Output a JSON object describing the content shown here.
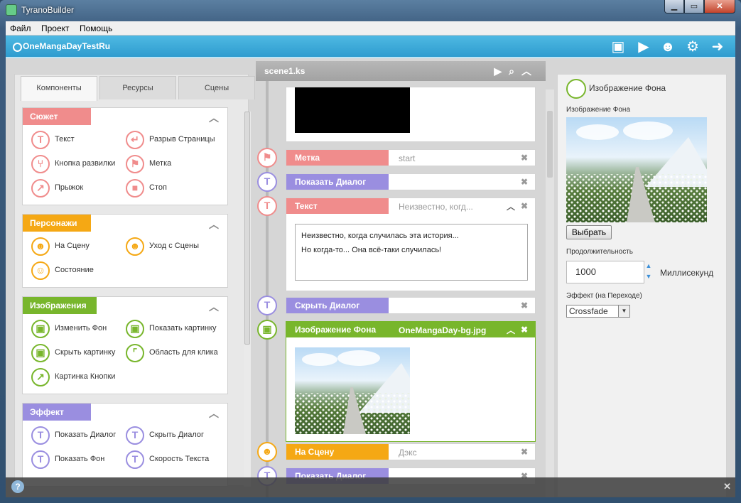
{
  "window": {
    "title": "TyranoBuilder",
    "min": "▁",
    "max": "▭",
    "close": "✕"
  },
  "menu": [
    "Файл",
    "Проект",
    "Помощь"
  ],
  "header": {
    "project": "OneMangaDayTestRu",
    "icons": [
      "save-icon",
      "play-icon",
      "characters-icon",
      "settings-icon",
      "exit-icon"
    ]
  },
  "tabs": [
    "Компоненты",
    "Ресурсы",
    "Сцены"
  ],
  "categories": [
    {
      "title": "Сюжет",
      "color": "#f08c8c",
      "items": [
        "Текст",
        "Разрыв Страницы",
        "Кнопка развилки",
        "Метка",
        "Прыжок",
        "Стоп"
      ]
    },
    {
      "title": "Персонажи",
      "color": "#f5a814",
      "items": [
        "На Сцену",
        "Уход с Сцены",
        "Состояние"
      ]
    },
    {
      "title": "Изображения",
      "color": "#78b62c",
      "items": [
        "Изменить Фон",
        "Показать картинку",
        "Скрыть картинку",
        "Область для клика",
        "Картинка Кнопки"
      ]
    },
    {
      "title": "Эффект",
      "color": "#9a8ee0",
      "items": [
        "Показать Диалог",
        "Скрыть Диалог",
        "Показать Фон",
        "Скорость Текста"
      ]
    }
  ],
  "scene": {
    "tab": "scene1.ks"
  },
  "commands": [
    {
      "name": "Метка",
      "value": "start",
      "color": "#f08c8c"
    },
    {
      "name": "Показать Диалог",
      "value": "",
      "color": "#9a8ee0"
    },
    {
      "name": "Текст",
      "value": "Неизвестно, когд...",
      "color": "#f08c8c"
    },
    {
      "name": "Скрыть Диалог",
      "value": "",
      "color": "#9a8ee0"
    },
    {
      "name": "Изображение Фона",
      "value": "OneMangaDay-bg.jpg",
      "color": "#78b62c"
    },
    {
      "name": "На Сцену",
      "value": "Дэкс",
      "color": "#f5a814"
    },
    {
      "name": "Показать Диалог",
      "value": "",
      "color": "#9a8ee0"
    }
  ],
  "text_area": {
    "line1": "Неизвестно, когда случилась эта история...",
    "line2": "Но когда-то... Она всё-таки случилась!"
  },
  "right": {
    "title": "Изображение Фона",
    "image_label": "Изображение Фона",
    "choose_btn": "Выбрать",
    "duration_label": "Продолжительность",
    "duration_value": "1000",
    "duration_unit": "Миллисекунд",
    "effect_label": "Эффект (на Переходе)",
    "effect_value": "Crossfade"
  },
  "bottom": {
    "help": "?",
    "close": "✕"
  }
}
